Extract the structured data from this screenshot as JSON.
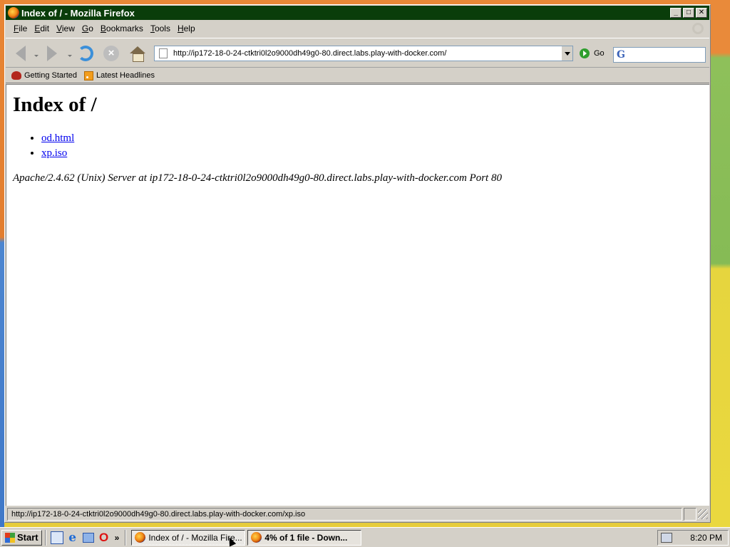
{
  "window": {
    "title": "Index of / - Mozilla Firefox",
    "buttons": {
      "minimize": "_",
      "maximize": "□",
      "close": "✕"
    }
  },
  "menubar": {
    "items": [
      {
        "label": "File",
        "key": "F",
        "rest": "ile"
      },
      {
        "label": "Edit",
        "key": "E",
        "rest": "dit"
      },
      {
        "label": "View",
        "key": "V",
        "rest": "iew"
      },
      {
        "label": "Go",
        "key": "G",
        "rest": "o"
      },
      {
        "label": "Bookmarks",
        "key": "B",
        "rest": "ookmarks"
      },
      {
        "label": "Tools",
        "key": "T",
        "rest": "ools"
      },
      {
        "label": "Help",
        "key": "H",
        "rest": "elp"
      }
    ]
  },
  "navbar": {
    "url": "http://ip172-18-0-24-ctktri0l2o9000dh49g0-80.direct.labs.play-with-docker.com/",
    "go_label": "Go",
    "search_engine_glyph": "G"
  },
  "bookmarks": {
    "items": [
      {
        "label": "Getting Started"
      },
      {
        "label": "Latest Headlines"
      }
    ]
  },
  "page": {
    "heading": "Index of /",
    "files": [
      "od.html",
      "xp.iso"
    ],
    "footer": "Apache/2.4.62 (Unix) Server at ip172-18-0-24-ctktri0l2o9000dh49g0-80.direct.labs.play-with-docker.com Port 80"
  },
  "statusbar": {
    "text": "http://ip172-18-0-24-ctktri0l2o9000dh49g0-80.direct.labs.play-with-docker.com/xp.iso"
  },
  "taskbar": {
    "start_label": "Start",
    "more_label": "»",
    "tasks": [
      {
        "label": "Index of / - Mozilla Fire..."
      },
      {
        "label": "4% of 1 file - Down..."
      }
    ],
    "clock": "8:20 PM"
  },
  "colors": {
    "titlebar": "#0a3d0a",
    "link": "#0000ee"
  }
}
